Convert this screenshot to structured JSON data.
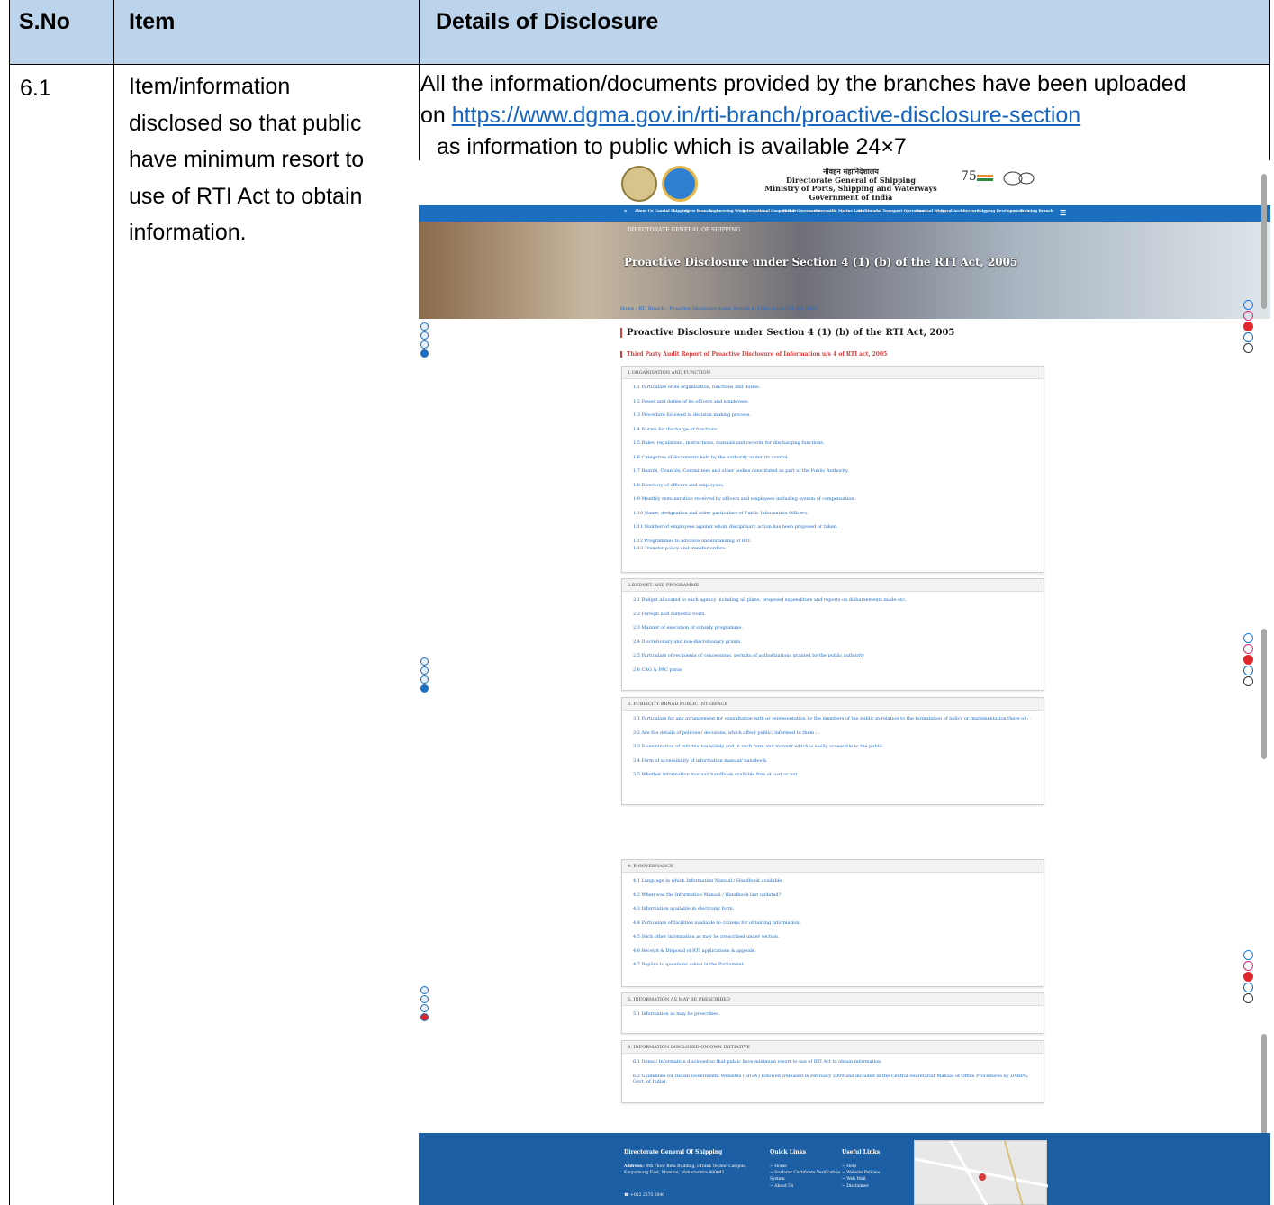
{
  "table": {
    "headers": [
      "S.No",
      "Item",
      "Details of Disclosure"
    ],
    "row": {
      "sno": "6.1",
      "item_lines": [
        "Item/information",
        "disclosed so that public",
        "have minimum resort to",
        "use of RTI Act to obtain",
        "information."
      ],
      "detail_line1": "All the information/documents provided by the branches have been uploaded",
      "detail_on": "on",
      "detail_link": "https://www.dgma.gov.in/rti-branch/proactive-disclosure-section",
      "detail_line3": "as information to public which is available 24×7"
    }
  },
  "screenshot": {
    "org_hindi": "नौवहन महानिदेशालय",
    "org_lines": [
      "Directorate General of Shipping",
      "Ministry of Ports, Shipping and Waterways",
      "Government of India"
    ],
    "nav_items": [
      "About Us",
      "Coastal Shipping",
      "Crew Branch",
      "Engineering Wing",
      "International Cooperation",
      "IT & E-Governance",
      "Mercantile Marine Law",
      "Multimodal Transport Operation",
      "Nautical Wing",
      "Naval Architecture",
      "Shipping Development",
      "Training Branch"
    ],
    "banner_label": "DIRECTORATE GENERAL OF SHIPPING",
    "banner_title": "Proactive Disclosure under Section 4 (1) (b) of the RTI Act, 2005",
    "breadcrumb": "Home  ›  RTI Branch  ›  Proactive Disclosure under Section 4 (1) (b) of the RTI Act, 2005",
    "page_heading": "Proactive Disclosure under Section 4 (1) (b) of the RTI Act, 2005",
    "page_subheading": "Third Party Audit Report of Proactive Disclosure of Information u/s 4 of RTI act, 2005",
    "sections": [
      {
        "title": "1.ORGANISATION AND FUNCTION",
        "items": [
          "1.1 Particulars of its organisation, functions and duties.",
          "1.2 Power and duties of its officers and employees.",
          "1.3 Procedure followed in decision making process.",
          "1.4 Norms for discharge of functions.",
          "1.5 Rules, regulations, instructions, manuals and records for discharging functions.",
          "1.6 Categories of documents held by the authority under its control.",
          "1.7 Boards, Councils, Committees and other bodies constituted as part of the Public Authority.",
          "1.8 Directory of officers and employees.",
          "1.9 Monthly remuneration received by officers and employees including system of compensation.",
          "1.10 Name, designation and other particulars of Public Information Officers.",
          "1.11 Number of employees against whom disciplinary action has been proposed or taken.",
          "1.12 Programmes to advance understanding of RTI.",
          "1.13 Transfer policy and transfer orders."
        ]
      },
      {
        "title": "2.BUDGET AND PROGRAMME",
        "items": [
          "2.1 Budget allocated to each agency including all plans, proposed expenditure and reports on disbursements made etc.",
          "2.2 Foreign and domestic tours.",
          "2.3 Manner of execution of subsidy programme.",
          "2.4 Discretionary and non-discretionary grants.",
          "2.5 Particulars of recipients of concessions, permits of authorizations granted by the public authority",
          "2.6 CAG & PAC paras"
        ]
      },
      {
        "title": "3. PUBLICITY BRNAD PUBLIC INTERFACE",
        "items": [
          "3.1 Particulars for any arrangement for consultation with or representation by the members of the public in relation to the formulation of policy or implementation there of : .",
          "3.2 Are the details of policies / decisions, which affect public, informed to them : .",
          "3.3 Dissemination of information widely and in such form and manner which is easily accessible to the public.",
          "3.4 Form of accessibility of information manual/ handbook.",
          "3.5 Whether information manual/ handbook available free of cost or not"
        ]
      },
      {
        "title": "4. E-GOVERNANCE",
        "items": [
          "4.1 Language in which Information Manual / Handbook available.",
          "4.2 When was the Information Manual / Handbook last updated?",
          "4.3 Information available in electronic form.",
          "4.4 Particulars of facilities available to citizens for obtaining information.",
          "4.5 Such other information as may be prescribed under section.",
          "4.6 Receipt & Disposal of RTI applications & appeals.",
          "4.7 Replies to questions asked in the Parliament."
        ]
      },
      {
        "title": "5. INFORMATION AS MAY BE PRESCRIBED",
        "items": [
          "5.1 Information as may be prescribed."
        ]
      },
      {
        "title": "6. INFORMATION DISCLOSED ON OWN INITIATIVE",
        "items": [
          "6.1 Items / Information disclosed so that public have minimum resort to use of RTI Act to obtain information.",
          "6.2 Guidelines for Indian Government Websites (GIGW) followed (released in February 2009 and included in the Central Secretariat Manual of Office Procedures by DARPG, Govt. of India)."
        ]
      }
    ],
    "footer": {
      "org_title": "Directorate General Of Shipping",
      "address_label": "Address:",
      "address": "- 9th Floor Beta Building, i-Think Techno Campus, Kanjurmarg East, Mumbai, Maharashtra 400042",
      "phone": "+022 2575 2040",
      "quick_title": "Quick Links",
      "quick_links": [
        "→ Home",
        "→ Seafarer Certificate Verification System",
        "→ About Us"
      ],
      "useful_title": "Useful Links",
      "useful_links": [
        "→ Help",
        "→ Website Policies",
        "→ Web Mail",
        "→ Disclaimer"
      ]
    }
  }
}
